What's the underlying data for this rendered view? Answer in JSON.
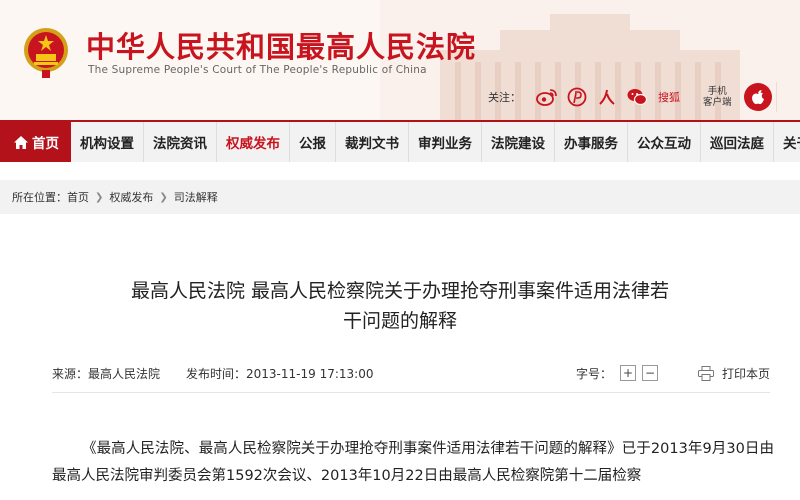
{
  "header": {
    "title": "中华人民共和国最高人民法院",
    "subtitle": "The Supreme People's Court of The People's Republic of China",
    "follow_label": "关注：",
    "sousou": "搜狐",
    "mobile_client_line1": "手机",
    "mobile_client_line2": "客户端",
    "icons": [
      "weibo-icon",
      "pinterest-icon",
      "renren-icon",
      "wechat-icon",
      "apple-icon"
    ],
    "brand_color": "#c8141e"
  },
  "nav": {
    "home": "首页",
    "items": [
      "机构设置",
      "法院资讯",
      "权威发布",
      "公报",
      "裁判文书",
      "审判业务",
      "法院建设",
      "办事服务",
      "公众互动",
      "巡回法庭",
      "关于我们"
    ],
    "active": "权威发布"
  },
  "breadcrumb": {
    "prefix": "所在位置：",
    "items": [
      "首页",
      "权威发布",
      "司法解释"
    ]
  },
  "article": {
    "title_line1": "最高人民法院 最高人民检察院关于办理抢夺刑事案件适用法律若",
    "title_line2": "干问题的解释",
    "source": "来源：最高人民法院",
    "published": "发布时间：2013-11-19 17:13:00",
    "font_size_label": "字号：",
    "font_plus": "+",
    "font_minus": "−",
    "print_label": "打印本页",
    "body": "《最高人民法院、最高人民检察院关于办理抢夺刑事案件适用法律若干问题的解释》已于2013年9月30日由最高人民法院审判委员会第1592次会议、2013年10月22日由最高人民检察院第十二届检察"
  }
}
